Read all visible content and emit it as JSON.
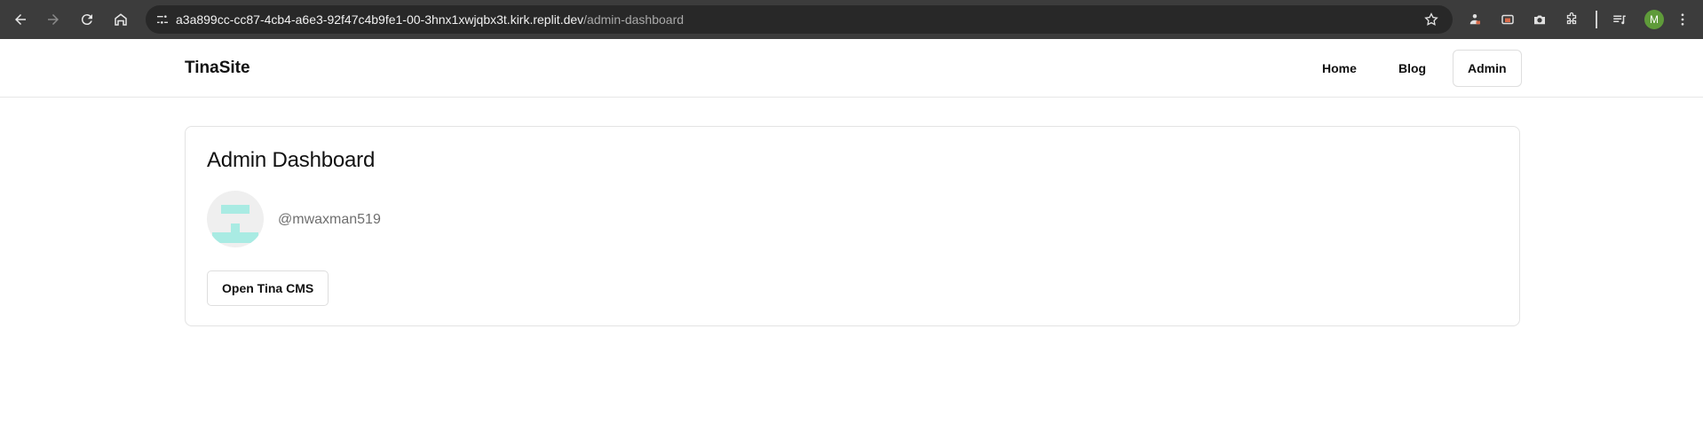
{
  "browser": {
    "url_host": "a3a899cc-cc87-4cb4-a6e3-92f47c4b9fe1-00-3hnx1xwjqbx3t.kirk.replit.dev",
    "url_path": "/admin-dashboard",
    "profile_initial": "M",
    "icons": {
      "back": "arrow-left-icon",
      "forward": "arrow-right-icon",
      "reload": "reload-icon",
      "home": "home-icon",
      "site_info": "tune-icon",
      "bookmark": "star-icon",
      "menu": "more-vert-icon"
    }
  },
  "site": {
    "brand": "TinaSite",
    "nav": [
      {
        "label": "Home"
      },
      {
        "label": "Blog"
      },
      {
        "label": "Admin"
      }
    ]
  },
  "dashboard": {
    "title": "Admin Dashboard",
    "username": "@mwaxman519",
    "open_cms_label": "Open Tina CMS",
    "avatar_color": "#a9ebe3"
  }
}
